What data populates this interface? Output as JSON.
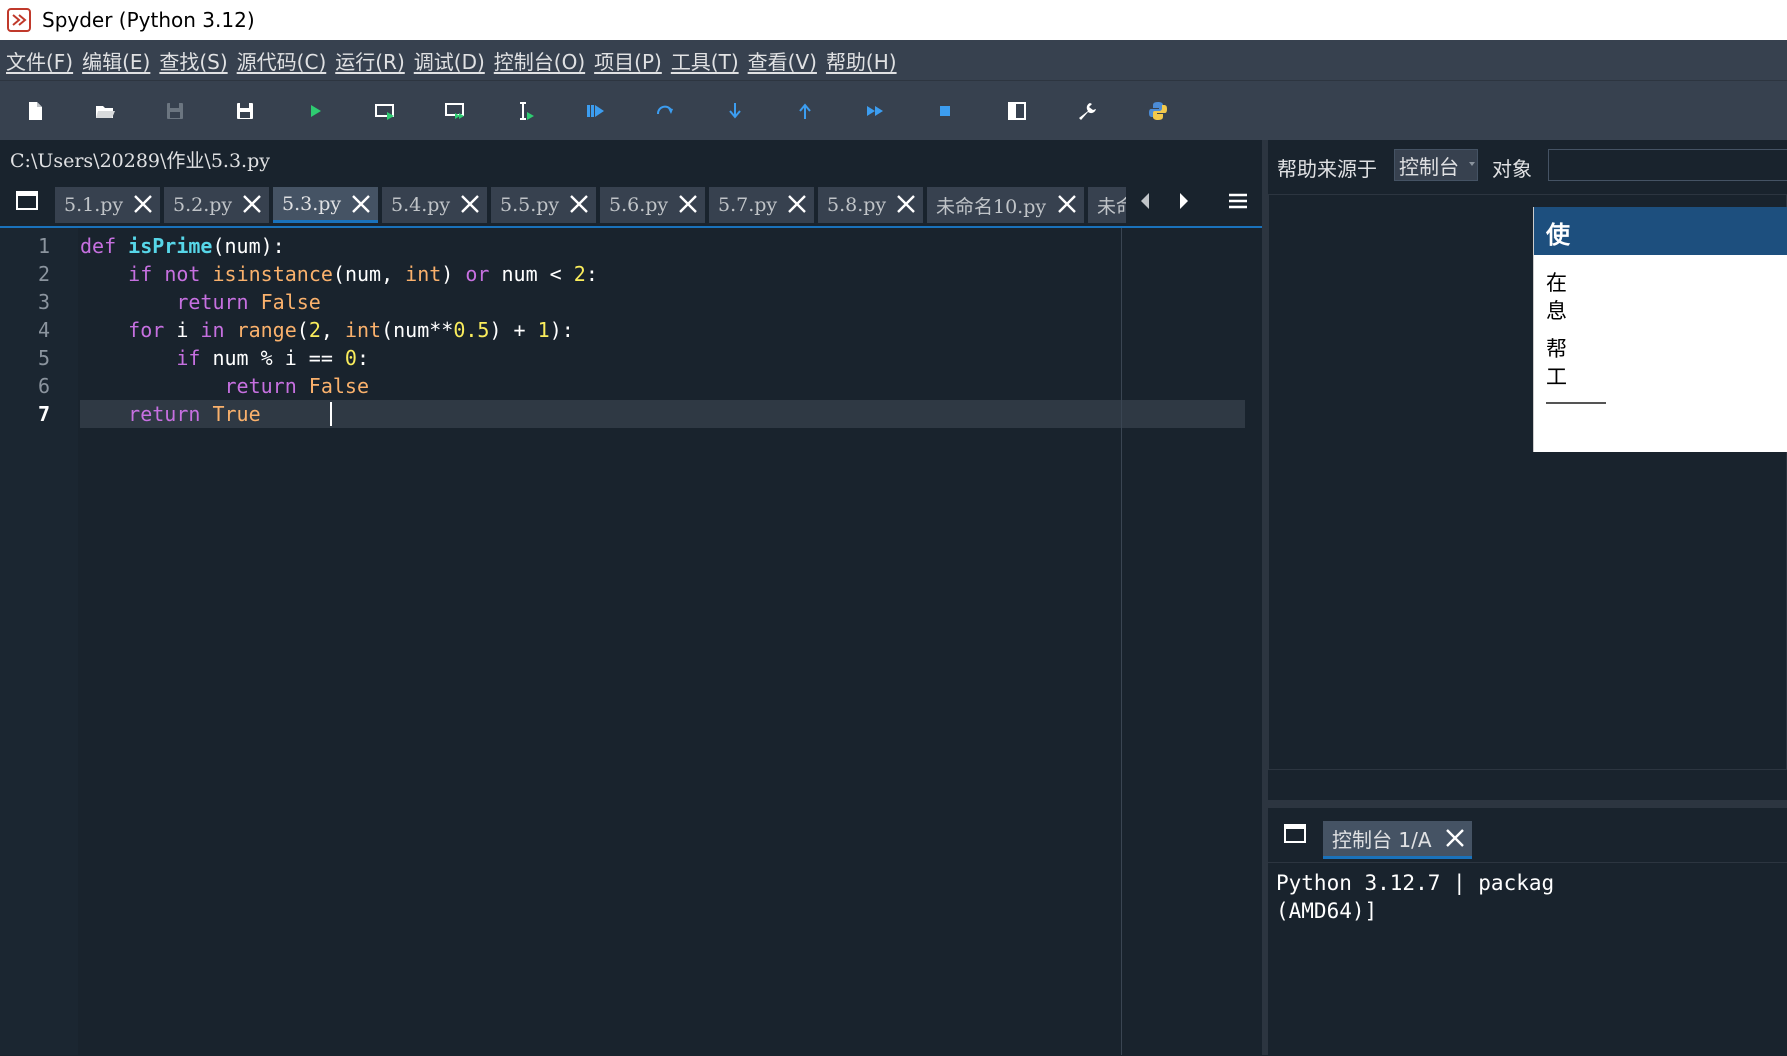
{
  "window": {
    "title": "Spyder (Python 3.12)"
  },
  "menubar": {
    "items": [
      "文件(F)",
      "编辑(E)",
      "查找(S)",
      "源代码(C)",
      "运行(R)",
      "调试(D)",
      "控制台(O)",
      "项目(P)",
      "工具(T)",
      "查看(V)",
      "帮助(H)"
    ]
  },
  "toolbar": {
    "buttons": [
      "new-file",
      "open-file",
      "save-file",
      "save-all",
      "run-file",
      "run-cell",
      "run-cell-advance",
      "run-selection",
      "debug",
      "step-over",
      "step-into",
      "step-return",
      "continue",
      "stop-debug",
      "maximize-pane",
      "preferences",
      "python-path-manager"
    ]
  },
  "editor": {
    "file_path": "C:\\Users\\20289\\作业\\5.3.py",
    "tabs": [
      {
        "label": "5.1.py",
        "active": false
      },
      {
        "label": "5.2.py",
        "active": false
      },
      {
        "label": "5.3.py",
        "active": true
      },
      {
        "label": "5.4.py",
        "active": false
      },
      {
        "label": "5.5.py",
        "active": false
      },
      {
        "label": "5.6.py",
        "active": false
      },
      {
        "label": "5.7.py",
        "active": false
      },
      {
        "label": "5.8.py",
        "active": false
      },
      {
        "label": "未命名10.py",
        "active": false
      },
      {
        "label": "未命",
        "active": false
      }
    ],
    "line_numbers": [
      "1",
      "2",
      "3",
      "4",
      "5",
      "6",
      "7"
    ],
    "current_line": 7,
    "code_lines": [
      "def isPrime(num):",
      "    if not isinstance(num, int) or num < 2:",
      "        return False",
      "    for i in range(2, int(num**0.5) + 1):",
      "        if num % i == 0:",
      "            return False",
      "    return True"
    ]
  },
  "help": {
    "source_label": "帮助来源于",
    "source_value": "控制台",
    "object_label": "对象",
    "card_title": "使",
    "card_lines": [
      "在",
      "息",
      "帮",
      "工"
    ]
  },
  "console": {
    "tab_label": "控制台 1/A",
    "output_lines": [
      "Python 3.12.7 | packag",
      "(AMD64)]"
    ]
  },
  "colors": {
    "background": "#19232d",
    "toolbar": "#37414f",
    "accent": "#1a72bb",
    "keyword": "#c670e0",
    "function": "#57d6e8",
    "builtin": "#fab16c",
    "number": "#faed5c"
  }
}
